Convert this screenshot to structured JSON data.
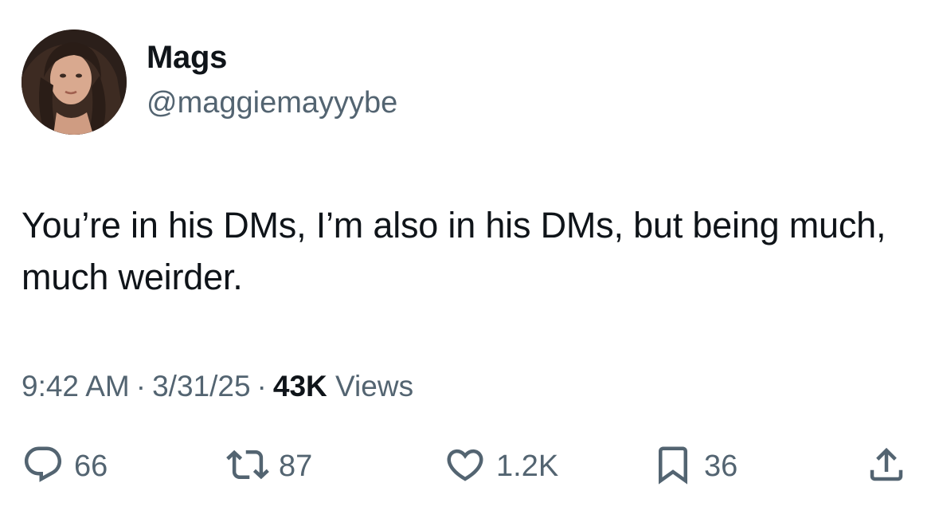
{
  "author": {
    "display_name": "Mags",
    "handle": "@maggiemayyybe"
  },
  "tweet": {
    "text": "You’re in his DMs, I’m also in his DMs, but being much, much weirder."
  },
  "meta": {
    "time": "9:42 AM",
    "separator": "·",
    "date": "3/31/25",
    "views_count": "43K",
    "views_label": "Views"
  },
  "actions": {
    "replies": "66",
    "reposts": "87",
    "likes": "1.2K",
    "bookmarks": "36"
  },
  "icons": {
    "reply": "reply-icon",
    "repost": "repost-icon",
    "like": "heart-icon",
    "bookmark": "bookmark-icon",
    "share": "share-icon"
  },
  "colors": {
    "text_primary": "#0f1419",
    "text_secondary": "#536471"
  }
}
